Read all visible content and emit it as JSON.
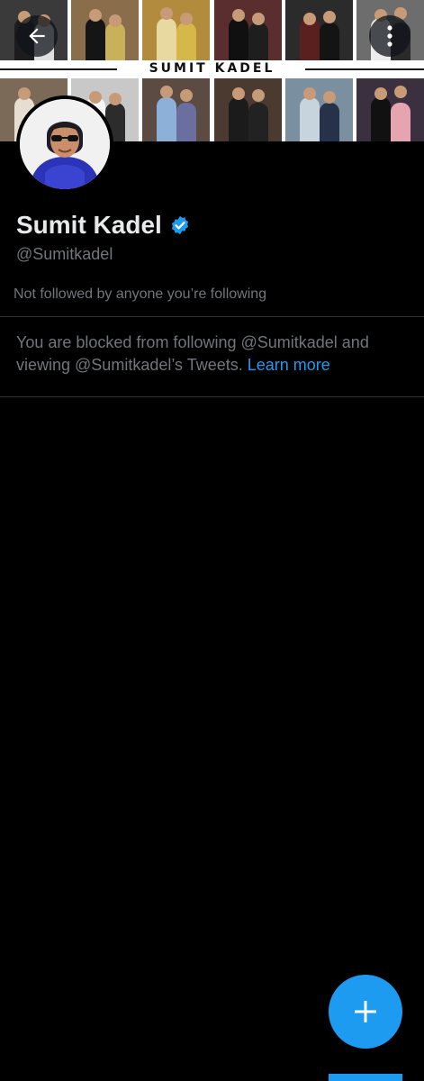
{
  "banner": {
    "title": "SUMIT KADEL",
    "top_tile_colors": [
      "#3a3a3a",
      "#8a6e4b",
      "#b38b3c",
      "#5a2e2e",
      "#2b2b2b",
      "#6d6d6d"
    ],
    "bottom_tile_colors": [
      "#7b6a58",
      "#c8c8c8",
      "#5b4b43",
      "#4a3a30",
      "#7a8fa0",
      "#3a3040"
    ]
  },
  "header": {
    "back_icon": "arrow-left-icon",
    "more_icon": "more-vertical-icon"
  },
  "profile": {
    "name": "Sumit Kadel",
    "handle": "@Sumitkadel",
    "verified_icon": "verified-badge-icon",
    "followed_by": "Not followed by anyone you’re following"
  },
  "blocked": {
    "message": "You are blocked from following @Sumitkadel and viewing @Sumitkadel’s Tweets.",
    "link": "Learn more"
  },
  "fab": {
    "icon": "plus-icon"
  },
  "colors": {
    "accent": "#1d9bf0",
    "background": "#000000",
    "text_primary": "#e7e9ea",
    "text_secondary": "#71767b",
    "divider": "#2f3336"
  }
}
